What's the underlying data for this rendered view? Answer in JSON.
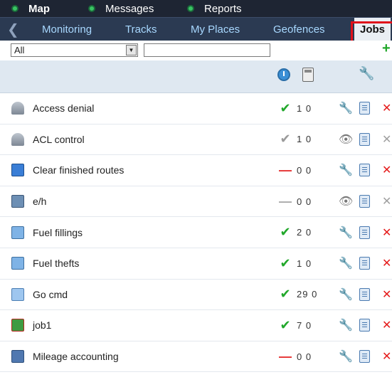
{
  "topnav": {
    "items": [
      {
        "label": "Map",
        "active": true
      },
      {
        "label": "Messages",
        "active": false
      },
      {
        "label": "Reports",
        "active": false
      }
    ]
  },
  "tabs": {
    "back_icon": "chevron-left-icon",
    "items": [
      {
        "label": "Monitoring",
        "active": false
      },
      {
        "label": "Tracks",
        "active": false
      },
      {
        "label": "My Places",
        "active": false
      },
      {
        "label": "Geofences",
        "active": false
      },
      {
        "label": "Jobs",
        "active": true
      }
    ]
  },
  "filter": {
    "select_value": "All",
    "search_value": "",
    "add_icon": "plus-icon"
  },
  "header": {
    "icons": [
      "power-icon",
      "calculator-icon",
      "wrench-icon"
    ]
  },
  "jobs": [
    {
      "name": "Access denial",
      "type_icon": "user-access-icon",
      "status": "ok",
      "count": "1 0",
      "action_icon": "wrench-icon",
      "delete_enabled": true
    },
    {
      "name": "ACL control",
      "type_icon": "user-access-icon",
      "status": "ok-gray",
      "count": "1 0",
      "action_icon": "eye-icon",
      "delete_enabled": false
    },
    {
      "name": "Clear finished routes",
      "type_icon": "routes-icon",
      "status": "dash",
      "count": "0 0",
      "action_icon": "wrench-icon",
      "delete_enabled": true
    },
    {
      "name": "e/h",
      "type_icon": "engine-hours-icon",
      "status": "dash-gray",
      "count": "0 0",
      "action_icon": "eye-icon",
      "delete_enabled": false
    },
    {
      "name": "Fuel fillings",
      "type_icon": "report-icon",
      "status": "ok",
      "count": "2 0",
      "action_icon": "wrench-icon",
      "delete_enabled": true
    },
    {
      "name": "Fuel thefts",
      "type_icon": "report-icon",
      "status": "ok",
      "count": "1 0",
      "action_icon": "wrench-icon",
      "delete_enabled": true
    },
    {
      "name": "Go cmd",
      "type_icon": "command-icon",
      "status": "ok",
      "count": "29 0",
      "action_icon": "wrench-icon",
      "delete_enabled": true
    },
    {
      "name": "job1",
      "type_icon": "job-icon",
      "status": "ok",
      "count": "7 0",
      "action_icon": "wrench-icon",
      "delete_enabled": true
    },
    {
      "name": "Mileage accounting",
      "type_icon": "counter-icon",
      "status": "dash",
      "count": "0 0",
      "action_icon": "wrench-icon",
      "delete_enabled": true
    }
  ],
  "colors": {
    "topbar": "#1e2533",
    "tabbar": "#2b3a52",
    "tab_text": "#a8d8ff",
    "ok": "#22a82b",
    "delete": "#e51b1b",
    "highlight_box": "#e0101a"
  }
}
